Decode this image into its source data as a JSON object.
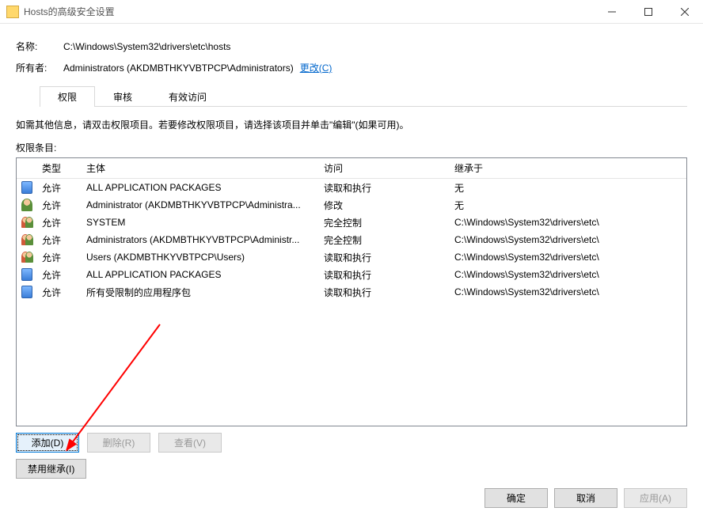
{
  "window": {
    "title": "Hosts的高级安全设置"
  },
  "fields": {
    "name_label": "名称:",
    "name_value": "C:\\Windows\\System32\\drivers\\etc\\hosts",
    "owner_label": "所有者:",
    "owner_value": "Administrators (AKDMBTHKYVBTPCP\\Administrators)",
    "change_link": "更改(C)"
  },
  "tabs": {
    "permissions": "权限",
    "audit": "审核",
    "effective": "有效访问"
  },
  "hint": "如需其他信息，请双击权限项目。若要修改权限项目，请选择该项目并单击\"编辑\"(如果可用)。",
  "entries_label": "权限条目:",
  "columns": {
    "type": "类型",
    "principal": "主体",
    "access": "访问",
    "inherit": "继承于"
  },
  "rows": [
    {
      "icon": "pkg",
      "type": "允许",
      "principal": "ALL APPLICATION PACKAGES",
      "access": "读取和执行",
      "inherit": "无"
    },
    {
      "icon": "user",
      "type": "允许",
      "principal": "Administrator (AKDMBTHKYVBTPCP\\Administra...",
      "access": "修改",
      "inherit": "无"
    },
    {
      "icon": "users",
      "type": "允许",
      "principal": "SYSTEM",
      "access": "完全控制",
      "inherit": "C:\\Windows\\System32\\drivers\\etc\\"
    },
    {
      "icon": "users",
      "type": "允许",
      "principal": "Administrators (AKDMBTHKYVBTPCP\\Administr...",
      "access": "完全控制",
      "inherit": "C:\\Windows\\System32\\drivers\\etc\\"
    },
    {
      "icon": "users",
      "type": "允许",
      "principal": "Users (AKDMBTHKYVBTPCP\\Users)",
      "access": "读取和执行",
      "inherit": "C:\\Windows\\System32\\drivers\\etc\\"
    },
    {
      "icon": "pkg",
      "type": "允许",
      "principal": "ALL APPLICATION PACKAGES",
      "access": "读取和执行",
      "inherit": "C:\\Windows\\System32\\drivers\\etc\\"
    },
    {
      "icon": "pkg",
      "type": "允许",
      "principal": "所有受限制的应用程序包",
      "access": "读取和执行",
      "inherit": "C:\\Windows\\System32\\drivers\\etc\\"
    }
  ],
  "buttons": {
    "add": "添加(D)",
    "remove": "删除(R)",
    "view": "查看(V)",
    "disable_inherit": "禁用继承(I)",
    "ok": "确定",
    "cancel": "取消",
    "apply": "应用(A)"
  }
}
